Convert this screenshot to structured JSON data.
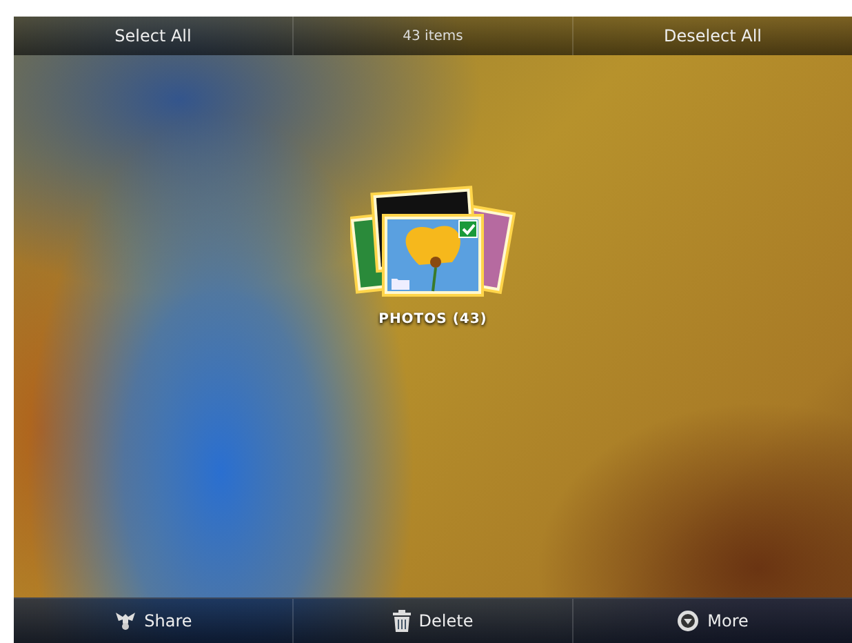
{
  "top_bar": {
    "select_all": "Select All",
    "count": "43 items",
    "deselect_all": "Deselect All"
  },
  "album": {
    "title": "PHOTOS (43)",
    "selected": true
  },
  "bottom_bar": [
    {
      "kind": "share",
      "label": "Share"
    },
    {
      "kind": "delete",
      "label": "Delete"
    },
    {
      "kind": "more",
      "label": "More"
    }
  ]
}
